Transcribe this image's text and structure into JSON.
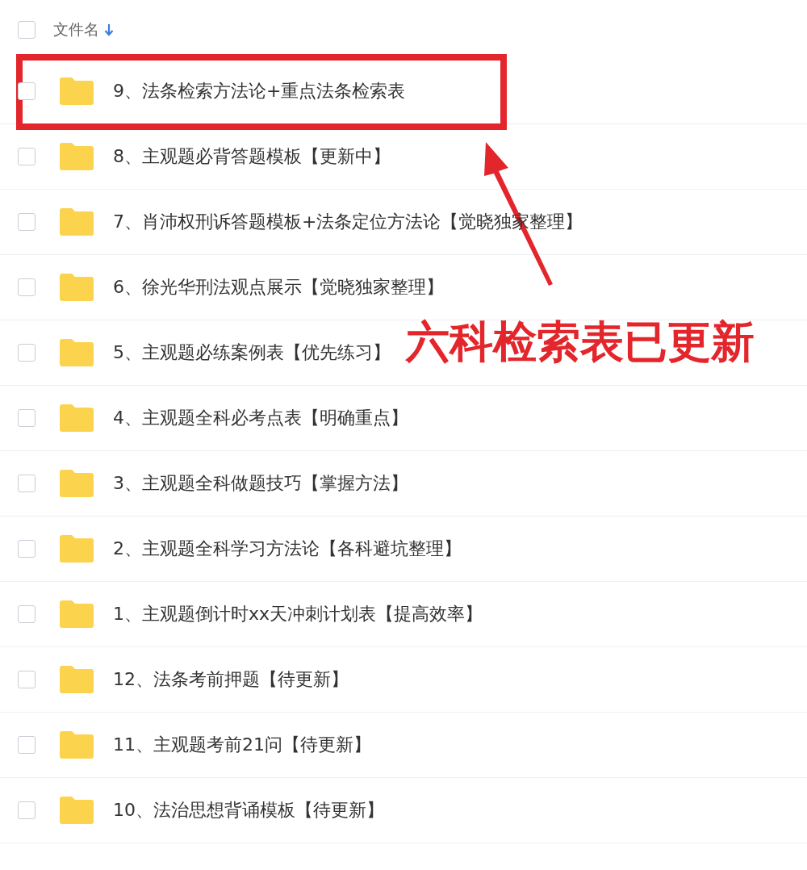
{
  "header": {
    "label": "文件名",
    "checked": false
  },
  "rows": [
    {
      "name": "9、法条检索方法论+重点法条检索表",
      "checked": false,
      "highlighted": true
    },
    {
      "name": "8、主观题必背答题模板【更新中】",
      "checked": false,
      "highlighted": false
    },
    {
      "name": "7、肖沛权刑诉答题模板+法条定位方法论【觉晓独家整理】",
      "checked": false,
      "highlighted": false
    },
    {
      "name": "6、徐光华刑法观点展示【觉晓独家整理】",
      "checked": false,
      "highlighted": false
    },
    {
      "name": "5、主观题必练案例表【优先练习】",
      "checked": false,
      "highlighted": false
    },
    {
      "name": "4、主观题全科必考点表【明确重点】",
      "checked": false,
      "highlighted": false
    },
    {
      "name": "3、主观题全科做题技巧【掌握方法】",
      "checked": false,
      "highlighted": false
    },
    {
      "name": "2、主观题全科学习方法论【各科避坑整理】",
      "checked": false,
      "highlighted": false
    },
    {
      "name": "1、主观题倒计时xx天冲刺计划表【提高效率】",
      "checked": false,
      "highlighted": false
    },
    {
      "name": "12、法条考前押题【待更新】",
      "checked": false,
      "highlighted": false
    },
    {
      "name": "11、主观题考前21问【待更新】",
      "checked": false,
      "highlighted": false
    },
    {
      "name": "10、法治思想背诵模板【待更新】",
      "checked": false,
      "highlighted": false
    }
  ],
  "annotation": {
    "text": "六科检索表已更新"
  }
}
